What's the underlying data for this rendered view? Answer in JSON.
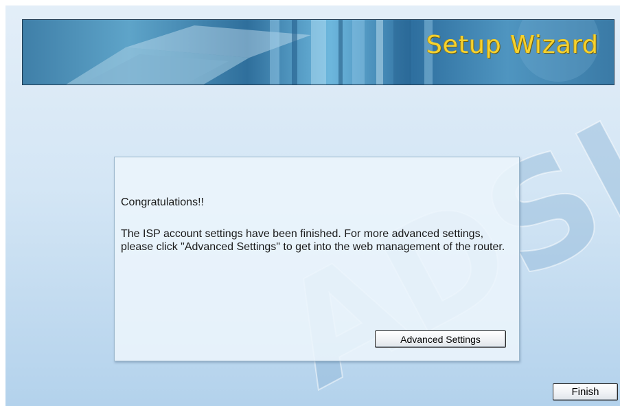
{
  "banner": {
    "title": "Setup Wizard",
    "title_color": "#f6d22e"
  },
  "watermark": {
    "text": "ADSL"
  },
  "message": {
    "heading": "Congratulations!!",
    "body": "The ISP account settings have been finished. For more advanced settings, please click \"Advanced Settings\" to get into the web management of the router."
  },
  "buttons": {
    "advanced_settings": "Advanced Settings",
    "finish": "Finish"
  }
}
